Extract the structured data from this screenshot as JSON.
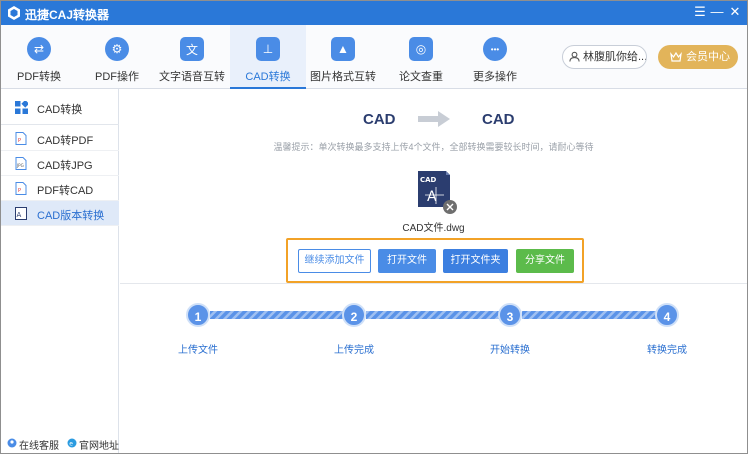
{
  "app": {
    "title": "迅捷CAJ转换器"
  },
  "window_controls": {
    "menu": "☰",
    "minimize": "—",
    "close": "✕"
  },
  "toolbar": {
    "items": [
      {
        "label": "PDF转换",
        "icon": "swap-icon",
        "glyph": "⇄"
      },
      {
        "label": "PDF操作",
        "icon": "gear-icon",
        "glyph": "⚙"
      },
      {
        "label": "文字语音互转",
        "icon": "text-voice-icon",
        "glyph": "文"
      },
      {
        "label": "CAD转换",
        "icon": "cad-icon",
        "glyph": "⊥"
      },
      {
        "label": "图片格式互转",
        "icon": "image-icon",
        "glyph": "▲"
      },
      {
        "label": "论文查重",
        "icon": "check-icon",
        "glyph": "◎"
      },
      {
        "label": "更多操作",
        "icon": "more-icon",
        "glyph": "•••"
      }
    ],
    "user_label": "林腹肌你给...",
    "vip_label": "会员中心"
  },
  "sidebar": {
    "header": "CAD转换",
    "items": [
      {
        "label": "CAD转PDF"
      },
      {
        "label": "CAD转JPG"
      },
      {
        "label": "PDF转CAD"
      },
      {
        "label": "CAD版本转换"
      }
    ],
    "footer": {
      "service": "在线客服",
      "website": "官网地址"
    }
  },
  "main": {
    "from_format": "CAD",
    "to_format": "CAD",
    "tip": "温馨提示：单次转换最多支持上传4个文件，全部转换需要较长时间，请耐心等待",
    "file_badge": "CAD",
    "file_name": "CAD文件.dwg",
    "buttons": {
      "add": "继续添加文件",
      "open": "打开文件",
      "open_folder": "打开文件夹",
      "share": "分享文件"
    },
    "steps": [
      {
        "num": "1",
        "label": "上传文件"
      },
      {
        "num": "2",
        "label": "上传完成"
      },
      {
        "num": "3",
        "label": "开始转换"
      },
      {
        "num": "4",
        "label": "转换完成"
      }
    ]
  },
  "colors": {
    "titlebar": "#2a78d8",
    "accent": "#4a8ce6",
    "vip": "#e2b45a",
    "share": "#5cbb4b",
    "highlight_border": "#f2a227"
  }
}
